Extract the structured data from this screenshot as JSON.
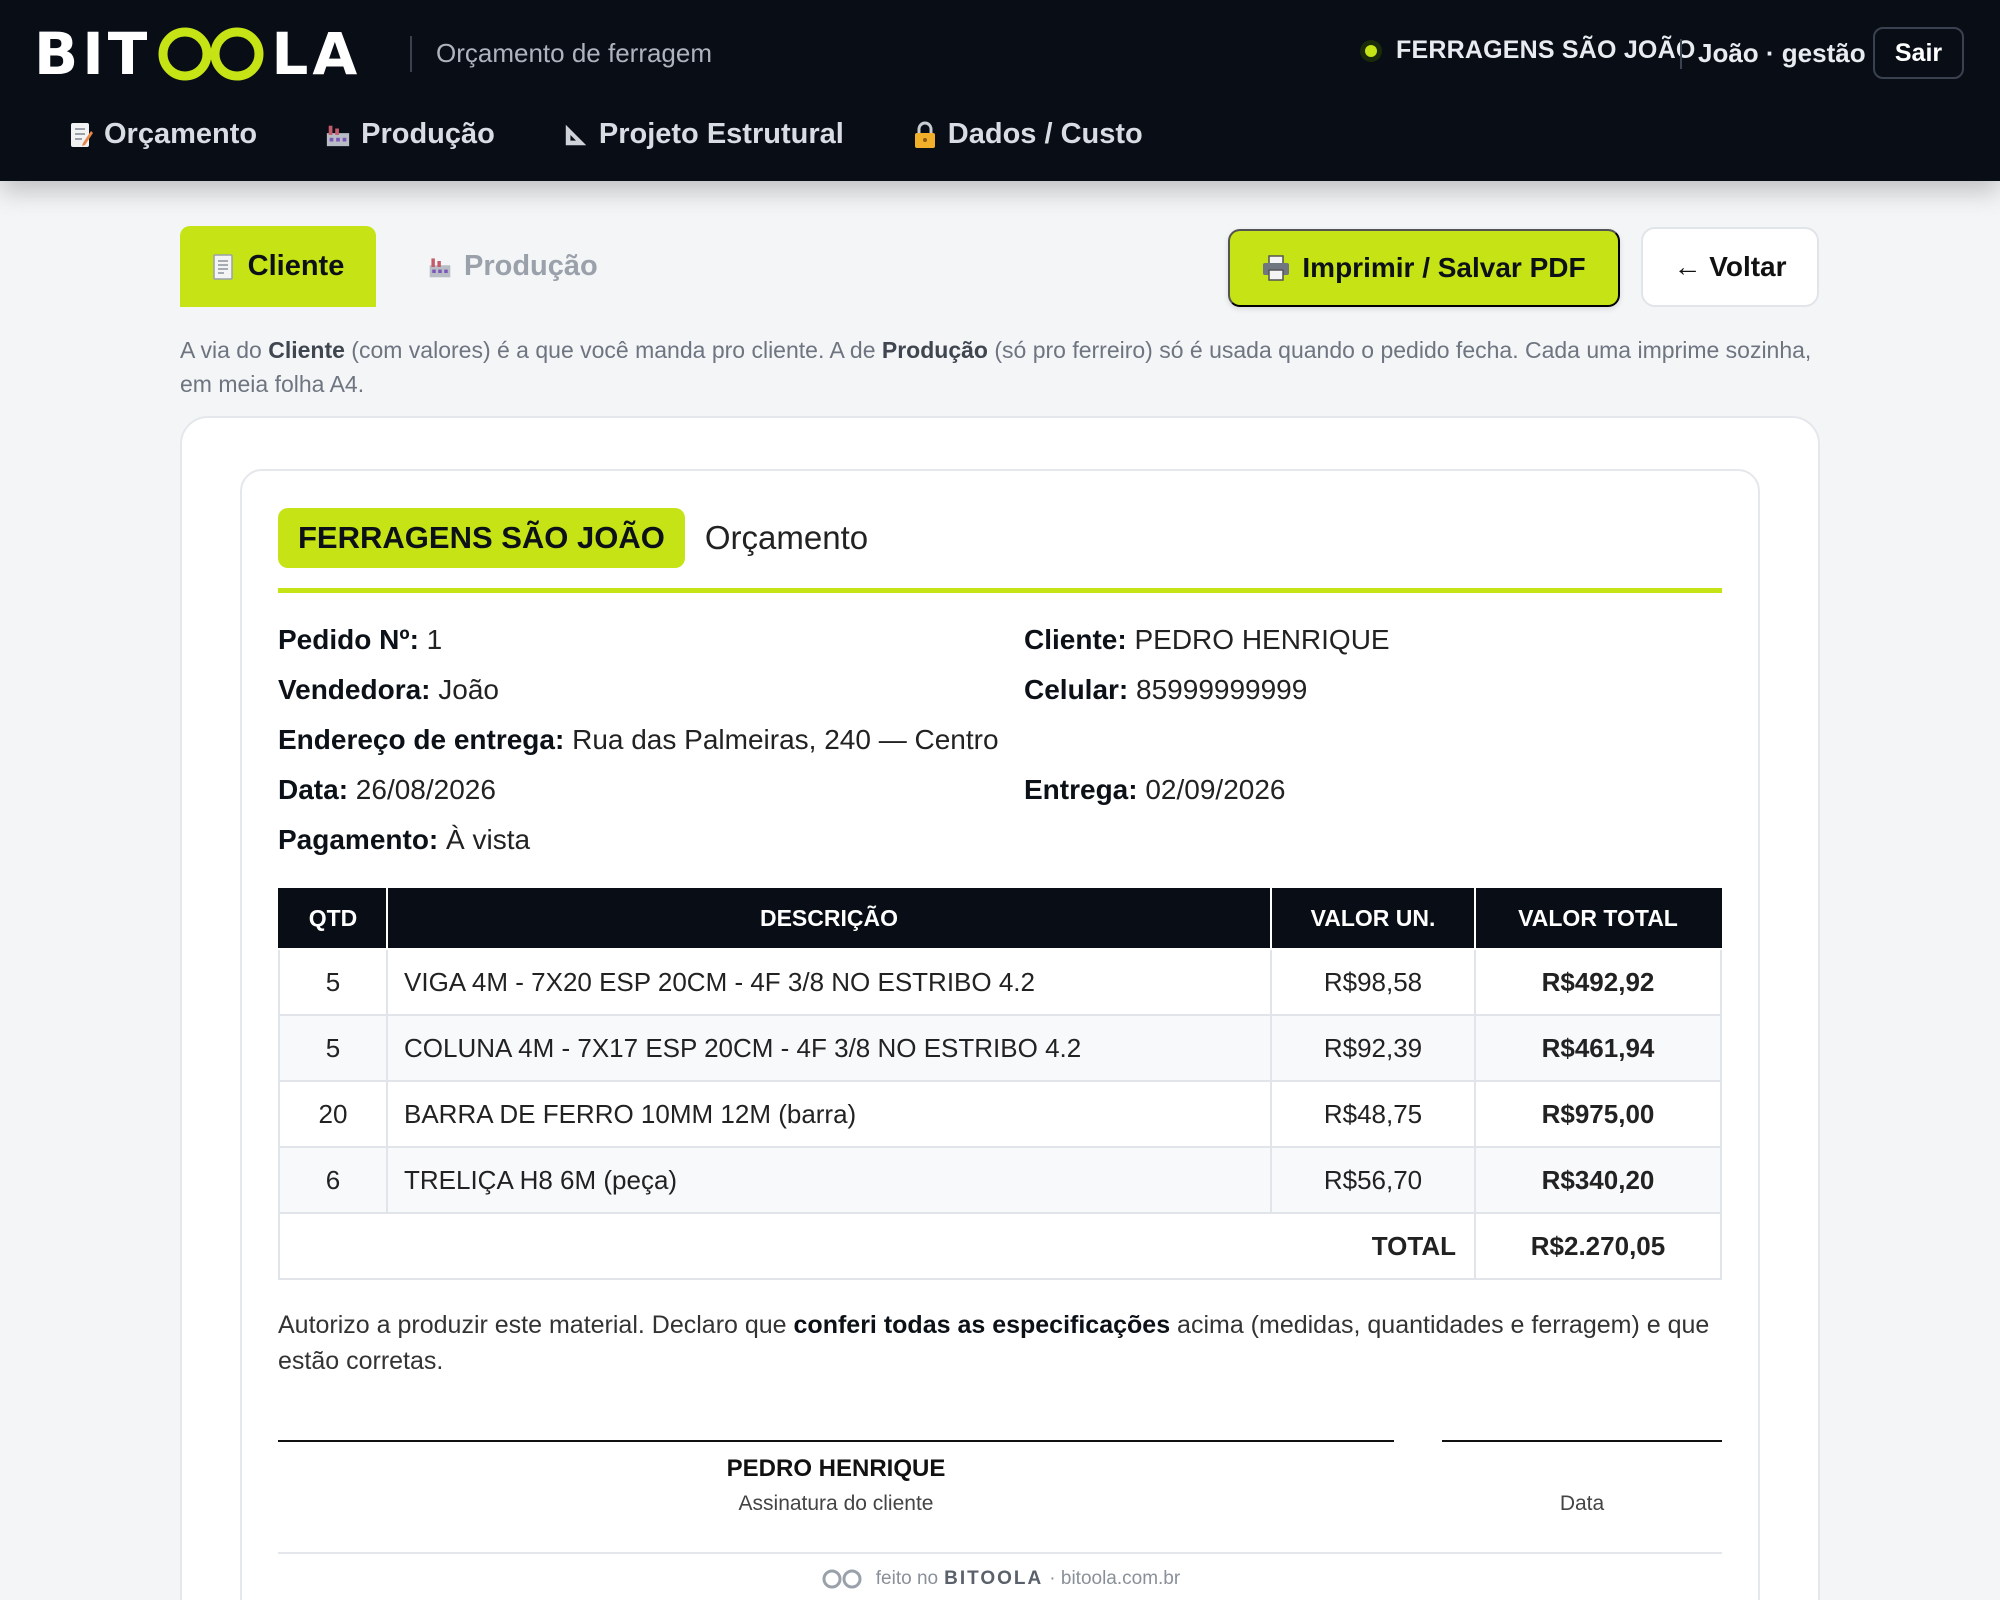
{
  "header": {
    "logo_left": "BIT",
    "logo_right": "LA",
    "subtitle": "Orçamento de ferragem",
    "company": "FERRAGENS SÃO JOÃO",
    "user": "João · gestão",
    "logout_label": "Sair",
    "accent_color": "#c5e315"
  },
  "nav": {
    "items": [
      {
        "label": "Orçamento",
        "icon": "memo-icon"
      },
      {
        "label": "Produção",
        "icon": "factory-icon"
      },
      {
        "label": "Projeto Estrutural",
        "icon": "triangle-ruler-icon"
      },
      {
        "label": "Dados / Custo",
        "icon": "lock-icon"
      }
    ]
  },
  "toolbar": {
    "tab_cliente": "Cliente",
    "tab_producao": "Produção",
    "print_label": "Imprimir / Salvar PDF",
    "back_label": "← Voltar"
  },
  "info": {
    "p1": "A via do ",
    "b1": "Cliente",
    "p2": " (com valores) é a que você manda pro cliente. A de ",
    "b2": "Produção",
    "p3": " (só pro ferreiro) só é usada quando o pedido fecha. Cada uma imprime sozinha, em meia folha A4."
  },
  "document": {
    "brand": "FERRAGENS SÃO JOÃO",
    "title": "Orçamento",
    "fields": {
      "pedido_label": "Pedido Nº:",
      "pedido_value": " 1",
      "cliente_label": "Cliente:",
      "cliente_value": " PEDRO HENRIQUE",
      "vendedora_label": "Vendedora:",
      "vendedora_value": " João",
      "celular_label": "Celular:",
      "celular_value": " 85999999999",
      "endereco_label": "Endereço de entrega:",
      "endereco_value": " Rua das Palmeiras, 240 — Centro",
      "data_label": "Data:",
      "data_value": " 26/08/2026",
      "entrega_label": "Entrega:",
      "entrega_value": " 02/09/2026",
      "pagamento_label": "Pagamento:",
      "pagamento_value": " À vista"
    },
    "table": {
      "headers": {
        "qtd": "QTD",
        "desc": "DESCRIÇÃO",
        "un": "VALOR UN.",
        "total": "VALOR TOTAL"
      },
      "rows": [
        {
          "qtd": "5",
          "desc": "VIGA 4M - 7X20 ESP 20CM - 4F 3/8 NO ESTRIBO 4.2",
          "un": "R$98,58",
          "total": "R$492,92"
        },
        {
          "qtd": "5",
          "desc": "COLUNA 4M - 7X17 ESP 20CM - 4F 3/8 NO ESTRIBO 4.2",
          "un": "R$92,39",
          "total": "R$461,94"
        },
        {
          "qtd": "20",
          "desc": "BARRA DE FERRO 10MM 12M (barra)",
          "un": "R$48,75",
          "total": "R$975,00"
        },
        {
          "qtd": "6",
          "desc": "TRELIÇA H8 6M (peça)",
          "un": "R$56,70",
          "total": "R$340,20"
        }
      ],
      "total_label": "TOTAL",
      "total_value": "R$2.270,05"
    },
    "authorization": {
      "p1": "Autorizo a produzir este material. Declaro que ",
      "b1": "conferi todas as especificações",
      "p2": " acima (medidas, quantidades e ferragem) e que estão corretas."
    },
    "signature": {
      "client_name": "PEDRO HENRIQUE",
      "client_caption": "Assinatura do cliente",
      "date_caption": "Data"
    },
    "footer": {
      "prefix": "feito no",
      "brand": "BITOOLA",
      "suffix": "· bitoola.com.br"
    }
  }
}
